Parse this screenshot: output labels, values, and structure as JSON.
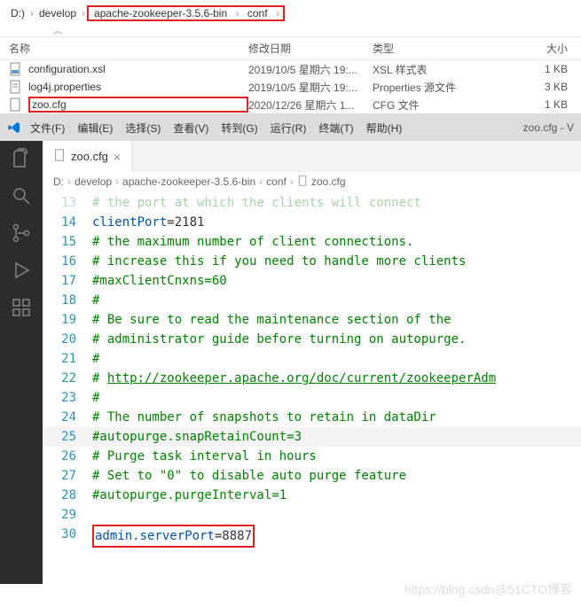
{
  "explorer": {
    "breadcrumb": {
      "root": "D:)",
      "dev": "develop",
      "zk": "apache-zookeeper-3.5.6-bin",
      "conf": "conf"
    },
    "columns": {
      "name": "名称",
      "date": "修改日期",
      "type": "类型",
      "size": "大小"
    },
    "rows": [
      {
        "name": "configuration.xsl",
        "date": "2019/10/5 星期六 19:...",
        "type": "XSL 样式表",
        "size": "1 KB"
      },
      {
        "name": "log4j.properties",
        "date": "2019/10/5 星期六 19:...",
        "type": "Properties 源文件",
        "size": "3 KB"
      },
      {
        "name": "zoo.cfg",
        "date": "2020/12/26 星期六 1...",
        "type": "CFG 文件",
        "size": "1 KB"
      }
    ]
  },
  "vscode": {
    "menu": [
      "文件(F)",
      "编辑(E)",
      "选择(S)",
      "查看(V)",
      "转到(G)",
      "运行(R)",
      "终端(T)",
      "帮助(H)"
    ],
    "title_right": "zoo.cfg - V",
    "tab": {
      "filename": "zoo.cfg",
      "close": "×"
    },
    "breadcrumb": [
      "D:",
      "develop",
      "apache-zookeeper-3.5.6-bin",
      "conf",
      "zoo.cfg"
    ],
    "code": {
      "l13": "# the port at which the clients will connect",
      "l14_key": "clientPort",
      "l14_val": "=2181",
      "l15": "# the maximum number of client connections.",
      "l16": "# increase this if you need to handle more clients",
      "l17": "#maxClientCnxns=60",
      "l18": "#",
      "l19": "# Be sure to read the maintenance section of the",
      "l20": "# administrator guide before turning on autopurge.",
      "l21": "#",
      "l22_a": "# ",
      "l22_b": "http://zookeeper.apache.org/doc/current/zookeeperAdm",
      "l23": "#",
      "l24": "# The number of snapshots to retain in dataDir",
      "l25": "#autopurge.snapRetainCount=3",
      "l26": "# Purge task interval in hours",
      "l27": "# Set to \"0\" to disable auto purge feature",
      "l28": "#autopurge.purgeInterval=1",
      "l29": "",
      "l30_key": "admin.serverPort",
      "l30_val": "=8887",
      "nums": [
        "13",
        "14",
        "15",
        "16",
        "17",
        "18",
        "19",
        "20",
        "21",
        "22",
        "23",
        "24",
        "25",
        "26",
        "27",
        "28",
        "29",
        "30"
      ]
    }
  },
  "watermark": "https://blog.csdn@51CTO博客"
}
